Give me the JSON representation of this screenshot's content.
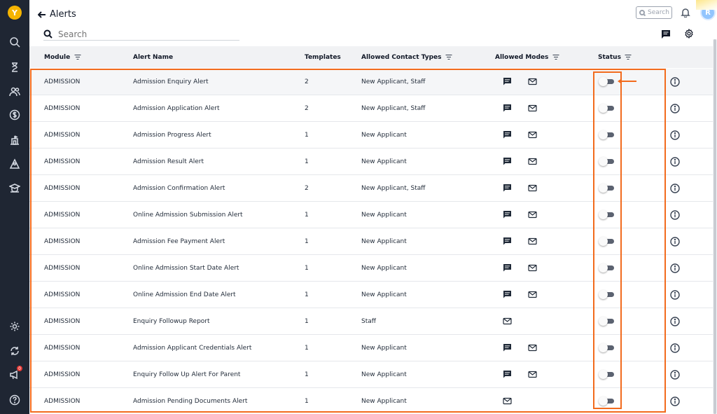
{
  "header": {
    "back_label": "Alerts",
    "search_placeholder": "Search",
    "mini_search_label": "Search",
    "avatar_initial": "R"
  },
  "table": {
    "columns": [
      "Module",
      "Alert Name",
      "Templates",
      "Allowed Contact Types",
      "Allowed Modes",
      "Status"
    ],
    "rows": [
      {
        "module": "ADMISSION",
        "name": "Admission Enquiry Alert",
        "templates": "2",
        "contacts": "New Applicant, Staff",
        "modes": [
          "sms",
          "email"
        ],
        "status": false
      },
      {
        "module": "ADMISSION",
        "name": "Admission Application Alert",
        "templates": "2",
        "contacts": "New Applicant, Staff",
        "modes": [
          "sms",
          "email"
        ],
        "status": false
      },
      {
        "module": "ADMISSION",
        "name": "Admission Progress Alert",
        "templates": "1",
        "contacts": "New Applicant",
        "modes": [
          "sms",
          "email"
        ],
        "status": false
      },
      {
        "module": "ADMISSION",
        "name": "Admission Result Alert",
        "templates": "1",
        "contacts": "New Applicant",
        "modes": [
          "sms",
          "email"
        ],
        "status": false
      },
      {
        "module": "ADMISSION",
        "name": "Admission Confirmation Alert",
        "templates": "2",
        "contacts": "New Applicant, Staff",
        "modes": [
          "sms",
          "email"
        ],
        "status": false
      },
      {
        "module": "ADMISSION",
        "name": "Online Admission Submission Alert",
        "templates": "1",
        "contacts": "New Applicant",
        "modes": [
          "sms",
          "email"
        ],
        "status": false
      },
      {
        "module": "ADMISSION",
        "name": "Admission Fee Payment Alert",
        "templates": "1",
        "contacts": "New Applicant",
        "modes": [
          "sms",
          "email"
        ],
        "status": false
      },
      {
        "module": "ADMISSION",
        "name": "Online Admission Start Date Alert",
        "templates": "1",
        "contacts": "New Applicant",
        "modes": [
          "sms",
          "email"
        ],
        "status": false
      },
      {
        "module": "ADMISSION",
        "name": "Online Admission End Date Alert",
        "templates": "1",
        "contacts": "New Applicant",
        "modes": [
          "sms",
          "email"
        ],
        "status": false
      },
      {
        "module": "ADMISSION",
        "name": "Enquiry Followup Report",
        "templates": "1",
        "contacts": "Staff",
        "modes": [
          "email"
        ],
        "status": false
      },
      {
        "module": "ADMISSION",
        "name": "Admission Applicant Credentials Alert",
        "templates": "1",
        "contacts": "New Applicant",
        "modes": [
          "sms",
          "email"
        ],
        "status": false
      },
      {
        "module": "ADMISSION",
        "name": "Enquiry Follow Up Alert For Parent",
        "templates": "1",
        "contacts": "New Applicant",
        "modes": [
          "sms",
          "email"
        ],
        "status": false
      },
      {
        "module": "ADMISSION",
        "name": "Admission Pending Documents Alert",
        "templates": "1",
        "contacts": "New Applicant",
        "modes": [
          "email"
        ],
        "status": false
      }
    ]
  },
  "sidebar": {
    "icons": [
      "logo-icon",
      "search-icon",
      "hourglass-icon",
      "users-icon",
      "dollar-icon",
      "building-icon",
      "group-icon",
      "school-icon",
      "settings-icon",
      "refresh-icon",
      "megaphone-icon",
      "help-icon"
    ],
    "notification_count": "0"
  },
  "colors": {
    "sidebar": "#1f2633",
    "highlight": "#f26b1d",
    "header_row": "#f1f2f4"
  }
}
